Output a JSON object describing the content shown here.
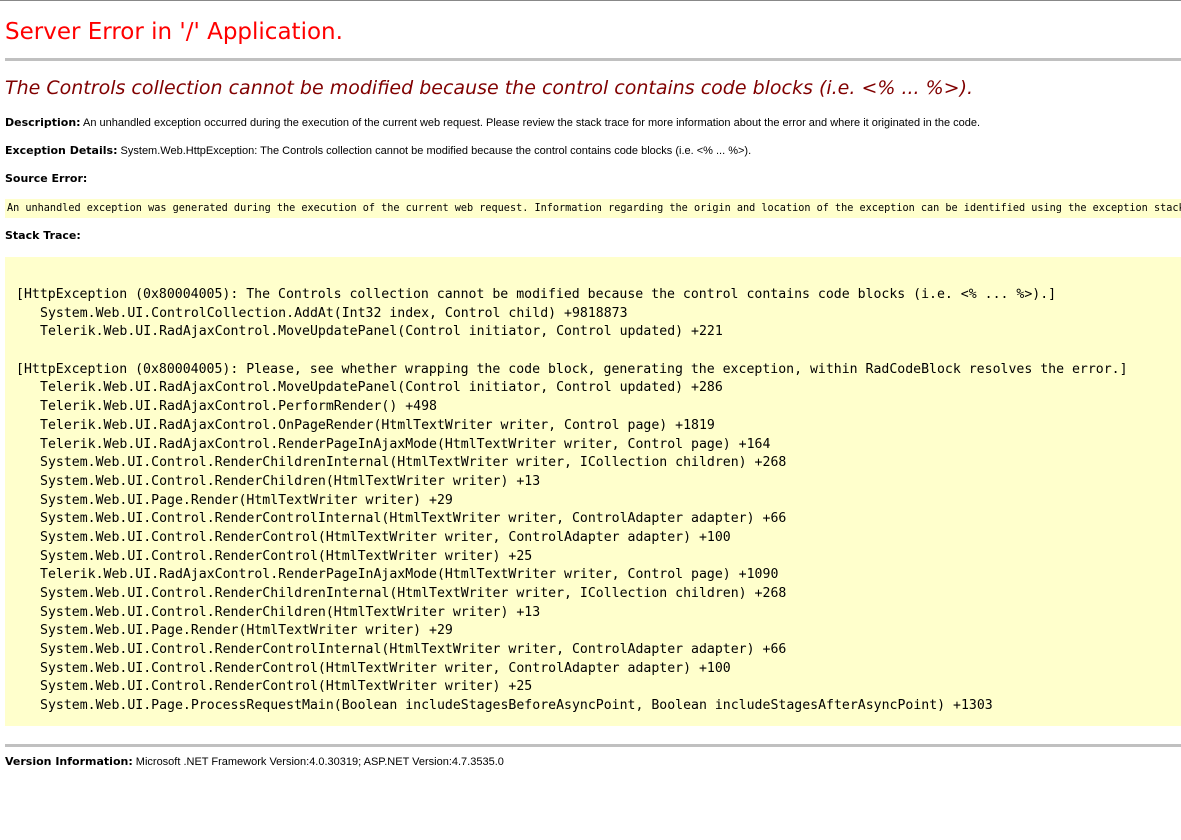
{
  "page": {
    "title": "Server Error in '/' Application.",
    "error_message": "The Controls collection cannot be modified because the control contains code blocks (i.e. <% ... %>)."
  },
  "description": {
    "label": "Description:",
    "text": "An unhandled exception occurred during the execution of the current web request. Please review the stack trace for more information about the error and where it originated in the code."
  },
  "exception_details": {
    "label": "Exception Details:",
    "text": "System.Web.HttpException: The Controls collection cannot be modified because the control contains code blocks (i.e. <% ... %>)."
  },
  "source_error": {
    "label": "Source Error:",
    "text": "An unhandled exception was generated during the execution of the current web request. Information regarding the origin and location of the exception can be identified using the exception stack trace below."
  },
  "stack_trace": {
    "label": "Stack Trace:",
    "exceptions": [
      {
        "header": "[HttpException (0x80004005): The Controls collection cannot be modified because the control contains code blocks (i.e. <% ... %>).]",
        "frames": [
          "System.Web.UI.ControlCollection.AddAt(Int32 index, Control child) +9818873",
          "Telerik.Web.UI.RadAjaxControl.MoveUpdatePanel(Control initiator, Control updated) +221"
        ]
      },
      {
        "header": "[HttpException (0x80004005): Please, see whether wrapping the code block, generating the exception, within RadCodeBlock resolves the error.]",
        "frames": [
          "Telerik.Web.UI.RadAjaxControl.MoveUpdatePanel(Control initiator, Control updated) +286",
          "Telerik.Web.UI.RadAjaxControl.PerformRender() +498",
          "Telerik.Web.UI.RadAjaxControl.OnPageRender(HtmlTextWriter writer, Control page) +1819",
          "Telerik.Web.UI.RadAjaxControl.RenderPageInAjaxMode(HtmlTextWriter writer, Control page) +164",
          "System.Web.UI.Control.RenderChildrenInternal(HtmlTextWriter writer, ICollection children) +268",
          "System.Web.UI.Control.RenderChildren(HtmlTextWriter writer) +13",
          "System.Web.UI.Page.Render(HtmlTextWriter writer) +29",
          "System.Web.UI.Control.RenderControlInternal(HtmlTextWriter writer, ControlAdapter adapter) +66",
          "System.Web.UI.Control.RenderControl(HtmlTextWriter writer, ControlAdapter adapter) +100",
          "System.Web.UI.Control.RenderControl(HtmlTextWriter writer) +25",
          "Telerik.Web.UI.RadAjaxControl.RenderPageInAjaxMode(HtmlTextWriter writer, Control page) +1090",
          "System.Web.UI.Control.RenderChildrenInternal(HtmlTextWriter writer, ICollection children) +268",
          "System.Web.UI.Control.RenderChildren(HtmlTextWriter writer) +13",
          "System.Web.UI.Page.Render(HtmlTextWriter writer) +29",
          "System.Web.UI.Control.RenderControlInternal(HtmlTextWriter writer, ControlAdapter adapter) +66",
          "System.Web.UI.Control.RenderControl(HtmlTextWriter writer, ControlAdapter adapter) +100",
          "System.Web.UI.Control.RenderControl(HtmlTextWriter writer) +25",
          "System.Web.UI.Page.ProcessRequestMain(Boolean includeStagesBeforeAsyncPoint, Boolean includeStagesAfterAsyncPoint) +1303"
        ]
      }
    ]
  },
  "version_info": {
    "label": "Version Information:",
    "text": "Microsoft .NET Framework Version:4.0.30319; ASP.NET Version:4.7.3535.0"
  },
  "colors": {
    "title": "#ff0000",
    "error_message": "#800000",
    "code_background": "#ffffcc",
    "rule": "#c0c0c0"
  }
}
